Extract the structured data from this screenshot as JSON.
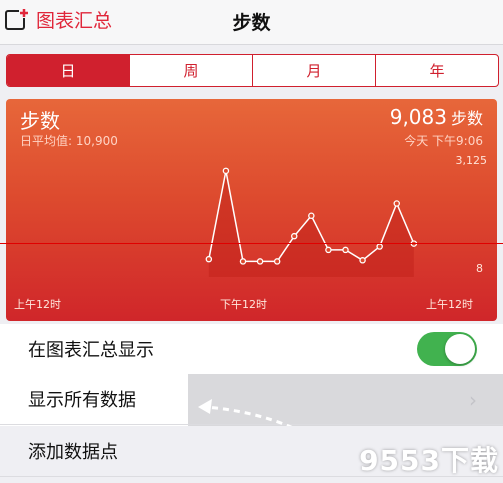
{
  "nav": {
    "back_label": "图表汇总",
    "title": "步数"
  },
  "segments": [
    {
      "label": "日",
      "active": true
    },
    {
      "label": "周",
      "active": false
    },
    {
      "label": "月",
      "active": false
    },
    {
      "label": "年",
      "active": false
    }
  ],
  "card": {
    "title": "步数",
    "avg_label": "日平均值: 10,900",
    "value": "9,083",
    "unit": "步数",
    "time": "今天 下午9:06",
    "gradient_top": "#e7673a",
    "gradient_bottom": "#d0262a"
  },
  "chart_data": {
    "type": "line",
    "x_tick_labels": [
      "上午12时",
      "下午12时",
      "上午12时"
    ],
    "y_tick_labels": [
      "3,125",
      "8"
    ],
    "ylim": [
      0,
      3125
    ],
    "points": [
      {
        "hour": 10,
        "steps": 480
      },
      {
        "hour": 11,
        "steps": 2860
      },
      {
        "hour": 12,
        "steps": 420
      },
      {
        "hour": 13,
        "steps": 420
      },
      {
        "hour": 14,
        "steps": 420
      },
      {
        "hour": 15,
        "steps": 1100
      },
      {
        "hour": 16,
        "steps": 1650
      },
      {
        "hour": 17,
        "steps": 730
      },
      {
        "hour": 18,
        "steps": 730
      },
      {
        "hour": 19,
        "steps": 450
      },
      {
        "hour": 20,
        "steps": 820
      },
      {
        "hour": 21,
        "steps": 1980
      },
      {
        "hour": 22,
        "steps": 900
      }
    ],
    "line_color": "#ffffff"
  },
  "rows": {
    "show_in_dashboard": "在图表汇总显示",
    "show_all_data": "显示所有数据",
    "add_data_point": "添加数据点"
  },
  "toggle_color": "#41b24f",
  "watermark": "9553下载"
}
